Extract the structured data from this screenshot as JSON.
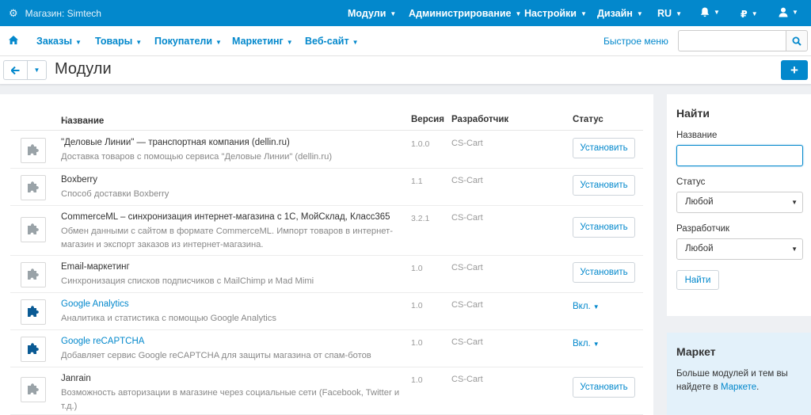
{
  "topbar": {
    "store": "Магазин: Simtech",
    "nav": [
      "Модули",
      "Администрирование",
      "Настройки",
      "Дизайн",
      "RU"
    ],
    "currency": "₽"
  },
  "subnav": {
    "items": [
      "Заказы",
      "Товары",
      "Покупатели",
      "Маркетинг",
      "Веб-сайт"
    ],
    "quick_menu": "Быстрое меню",
    "search_placeholder": ""
  },
  "page": {
    "title": "Модули"
  },
  "table": {
    "headers": {
      "name": "Название",
      "version": "Версия",
      "developer": "Разработчик",
      "status": "Статус"
    },
    "rows": [
      {
        "name": "\"Деловые Линии\" — транспортная компания (dellin.ru)",
        "desc": "Доставка товаров с помощью сервиса \"Деловые Линии\" (dellin.ru)",
        "version": "1.0.0",
        "developer": "CS-Cart",
        "action": "Установить",
        "active": false
      },
      {
        "name": "Boxberry",
        "desc": "Способ доставки Boxberry",
        "version": "1.1",
        "developer": "CS-Cart",
        "action": "Установить",
        "active": false
      },
      {
        "name": "CommerceML – синхронизация интернет-магазина с 1С, МойСклад, Класс365",
        "desc": "Обмен данными с сайтом в формате CommerceML. Импорт товаров в интернет-магазин и экспорт заказов из интернет-магазина.",
        "version": "3.2.1",
        "developer": "CS-Cart",
        "action": "Установить",
        "active": false
      },
      {
        "name": "Email-маркетинг",
        "desc": "Синхронизация списков подписчиков с MailChimp и Mad Mimi",
        "version": "1.0",
        "developer": "CS-Cart",
        "action": "Установить",
        "active": false
      },
      {
        "name": "Google Analytics",
        "desc": "Аналитика и статистика с помощью Google Analytics",
        "version": "1.0",
        "developer": "CS-Cart",
        "action": "Вкл.",
        "active": true
      },
      {
        "name": "Google reCAPTCHA",
        "desc": "Добавляет сервис Google reCAPTCHA для защиты магазина от спам-ботов",
        "version": "1.0",
        "developer": "CS-Cart",
        "action": "Вкл.",
        "active": true
      },
      {
        "name": "Janrain",
        "desc": "Возможность авторизации в магазине через социальные сети (Facebook, Twitter и т.д.)",
        "version": "1.0",
        "developer": "CS-Cart",
        "action": "Установить",
        "active": false
      }
    ]
  },
  "find": {
    "title": "Найти",
    "name_label": "Название",
    "status_label": "Статус",
    "status_value": "Любой",
    "developer_label": "Разработчик",
    "developer_value": "Любой",
    "button": "Найти"
  },
  "market": {
    "title": "Маркет",
    "text": "Больше модулей и тем вы найдете в ",
    "link": "Маркете",
    "suffix": "."
  },
  "colors": {
    "accent": "#0388cc",
    "addon_active": "#0a5a94",
    "addon_inactive": "#9aa3a8"
  }
}
